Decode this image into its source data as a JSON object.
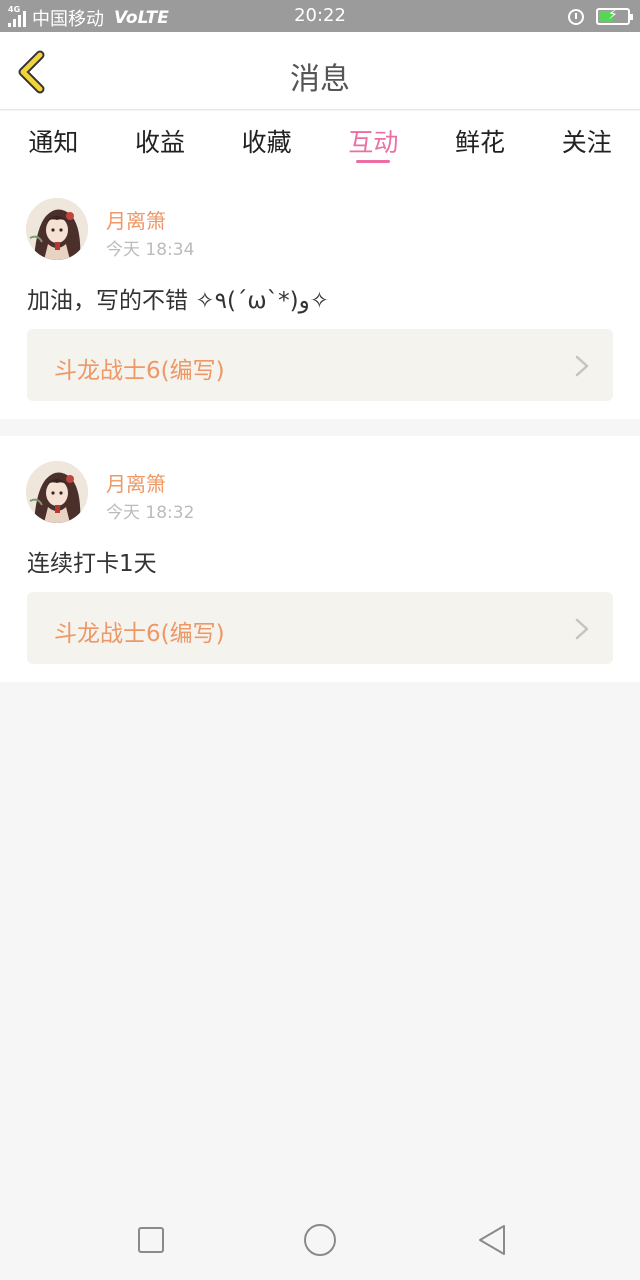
{
  "status_bar": {
    "network_tag": "4G",
    "carrier": "中国移动",
    "volte": "VoLTE",
    "time": "20:22",
    "icons": [
      "signal-icon",
      "alarm-icon",
      "battery-charging-icon"
    ]
  },
  "header": {
    "title": "消息",
    "back_icon": "chevron-left-icon"
  },
  "tabs": [
    {
      "label": "通知",
      "active": false
    },
    {
      "label": "收益",
      "active": false
    },
    {
      "label": "收藏",
      "active": false
    },
    {
      "label": "互动",
      "active": true
    },
    {
      "label": "鲜花",
      "active": false
    },
    {
      "label": "关注",
      "active": false
    }
  ],
  "messages": [
    {
      "username": "月离箫",
      "time": "今天 18:34",
      "content": "加油，写的不错 ✧٩(ˊωˋ*)و✧",
      "book_title": "斗龙战士6(编写)"
    },
    {
      "username": "月离箫",
      "time": "今天 18:32",
      "content": "连续打卡1天",
      "book_title": "斗龙战士6(编写)"
    }
  ],
  "colors": {
    "accent": "#ec6fa4",
    "username": "#ee9867",
    "link_bg": "#f4f3ed",
    "page_bg": "#f7f6f6",
    "back_icon": "#f1d43c"
  },
  "nav_bar": {
    "icons": [
      "recent-apps-icon",
      "home-icon",
      "back-triangle-icon"
    ]
  }
}
